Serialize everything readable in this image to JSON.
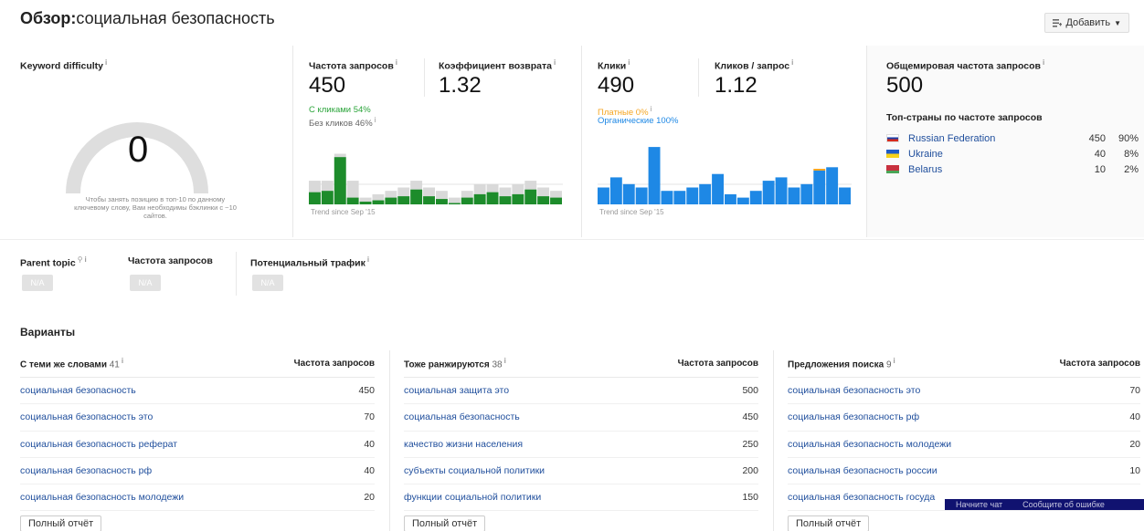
{
  "header": {
    "title_bold": "Обзор:",
    "title_rest": "социальная безопасность",
    "add_label": "Добавить",
    "add_icon": "add-list-icon"
  },
  "difficulty": {
    "label": "Keyword difficulty",
    "value": "0",
    "note": "Чтобы занять позицию в топ-10 по данному ключевому слову, Вам необходимы бэклинки с ~10 сайтов.",
    "gauge_fraction": 0
  },
  "volume": {
    "label": "Частота запросов",
    "value": "450",
    "clicks_pct": "С кликами 54%",
    "no_clicks_pct": "Без кликов 46%",
    "return_label": "Коэффициент возврата",
    "return_value": "1.32",
    "trend_note": "Trend since Sep '15",
    "bars_bg": [
      0.35,
      0.35,
      0.75,
      0.35,
      0.1,
      0.15,
      0.2,
      0.25,
      0.35,
      0.25,
      0.2,
      0.1,
      0.2,
      0.3,
      0.3,
      0.25,
      0.3,
      0.35,
      0.25,
      0.2
    ],
    "bars_fg": [
      0.18,
      0.2,
      0.7,
      0.1,
      0.04,
      0.06,
      0.1,
      0.12,
      0.22,
      0.12,
      0.08,
      0.02,
      0.1,
      0.15,
      0.18,
      0.12,
      0.15,
      0.22,
      0.12,
      0.1
    ],
    "colors": {
      "green": "#1d8c2b",
      "grey": "#d9d9d9",
      "accent_text": "#2aa43a"
    }
  },
  "clicks": {
    "label": "Клики",
    "value": "490",
    "paid": "Платные 0%",
    "organic": "Органические 100%",
    "cps_label": "Кликов / запрос",
    "cps_value": "1.12",
    "trend_note": "Trend since Sep '15",
    "bars": [
      0.25,
      0.4,
      0.3,
      0.25,
      0.85,
      0.2,
      0.2,
      0.25,
      0.3,
      0.45,
      0.15,
      0.1,
      0.2,
      0.35,
      0.4,
      0.25,
      0.3,
      0.5,
      0.55,
      0.25
    ],
    "paid_marker_index": 17,
    "colors": {
      "blue": "#1e88e5",
      "paid": "#f5a623",
      "organic_text": "#1e88e5"
    }
  },
  "global": {
    "label": "Общемировая частота запросов",
    "value": "500",
    "top_label": "Топ-страны по частоте запросов",
    "countries": [
      {
        "name": "Russian Federation",
        "volume": "450",
        "pct": "90%",
        "flag": "russia-flag-icon"
      },
      {
        "name": "Ukraine",
        "volume": "40",
        "pct": "8%",
        "flag": "ukraine-flag-icon"
      },
      {
        "name": "Belarus",
        "volume": "10",
        "pct": "2%",
        "flag": "belarus-flag-icon"
      }
    ]
  },
  "parent": {
    "topic_label": "Parent topic",
    "volume_label": "Частота запросов",
    "traffic_label": "Потенциальный трафик",
    "na": "N/A"
  },
  "variants": {
    "title": "Варианты",
    "volume_header": "Частота запросов",
    "full_report": "Полный отчёт",
    "columns": [
      {
        "title": "С теми же словами",
        "count": "41",
        "rows": [
          {
            "kw": "социальная безопасность",
            "v": "450"
          },
          {
            "kw": "социальная безопасность это",
            "v": "70"
          },
          {
            "kw": "социальная безопасность реферат",
            "v": "40"
          },
          {
            "kw": "социальная безопасность рф",
            "v": "40"
          },
          {
            "kw": "социальная безопасность молодежи",
            "v": "20"
          }
        ]
      },
      {
        "title": "Тоже ранжируются",
        "count": "38",
        "rows": [
          {
            "kw": "социальная защита это",
            "v": "500"
          },
          {
            "kw": "социальная безопасность",
            "v": "450"
          },
          {
            "kw": "качество жизни населения",
            "v": "250"
          },
          {
            "kw": "субъекты социальной политики",
            "v": "200"
          },
          {
            "kw": "функции социальной политики",
            "v": "150"
          }
        ]
      },
      {
        "title": "Предложения поиска",
        "count": "9",
        "rows": [
          {
            "kw": "социальная безопасность это",
            "v": "70"
          },
          {
            "kw": "социальная безопасность рф",
            "v": "40"
          },
          {
            "kw": "социальная безопасность молодежи",
            "v": "20"
          },
          {
            "kw": "социальная безопасность россии",
            "v": "10"
          },
          {
            "kw": "социальная безопасность госуда",
            "v": ""
          }
        ]
      }
    ]
  },
  "overlay": {
    "chat": "Начните чат",
    "report": "Сообщите об ошибке"
  }
}
